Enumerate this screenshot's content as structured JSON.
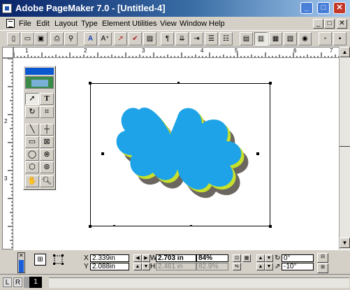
{
  "window": {
    "title": "Adobe PageMaker 7.0 - [Untitled-4]",
    "minimize": "_",
    "maximize": "□",
    "close": "✕"
  },
  "menu": {
    "items": [
      "File",
      "Edit",
      "Layout",
      "Type",
      "Element",
      "Utilities",
      "View",
      "Window",
      "Help"
    ],
    "doc_min": "_",
    "doc_restore": "□",
    "doc_close": "✕"
  },
  "ruler": {
    "top_labels": [
      "1",
      "2",
      "3",
      "4",
      "5",
      "6",
      "7"
    ],
    "left_labels": [
      "2",
      "3"
    ]
  },
  "control_palette": {
    "x_label": "X",
    "y_label": "Y",
    "x_value": "2.339in",
    "y_value": "2.088in",
    "w_label": "W",
    "h_label": "H",
    "w_value": "2.703 in",
    "h_value": "2.461 in",
    "w_percent": "84%",
    "h_percent": "82.9%",
    "rotation": "0°",
    "skew": "-10°"
  },
  "pages": {
    "left_label": "L",
    "right_label": "R",
    "current_page": "1"
  },
  "colors": {
    "titlebar_start": "#0a246a",
    "shape_fill": "#1ea3e8",
    "shape_outline": "#c6e02c",
    "shadow": "#6b6760"
  }
}
